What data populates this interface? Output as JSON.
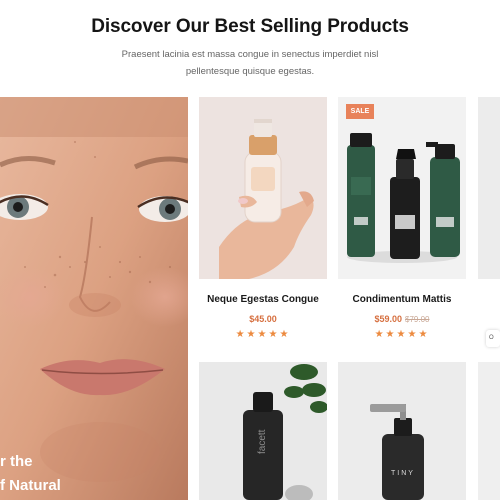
{
  "section": {
    "title": "Discover Our Best Selling Products",
    "subtitle_line1": "Praesent lacinia est massa congue in senectus imperdiet nisl",
    "subtitle_line2": "pellentesque quisque egestas."
  },
  "hero": {
    "line1": "r the",
    "line2": "f Natural"
  },
  "products": [
    {
      "name": "Neque Egestas Congue",
      "price": "$45.00",
      "old_price": "",
      "rating": 5,
      "badge": "",
      "stars": "★★★★★"
    },
    {
      "name": "Condimentum Mattis",
      "price": "$59.00",
      "old_price": "$79.00",
      "rating": 5,
      "badge": "SALE",
      "stars": "★★★★★"
    }
  ],
  "product_labels": {
    "bottle_a": "facett",
    "bottle_b": "TINY"
  },
  "side_pill": "O",
  "colors": {
    "accent_price": "#d66f3f",
    "stars": "#ec8a3f",
    "sale_badge": "#e8825a",
    "bottle_green": "#2f5a45"
  }
}
